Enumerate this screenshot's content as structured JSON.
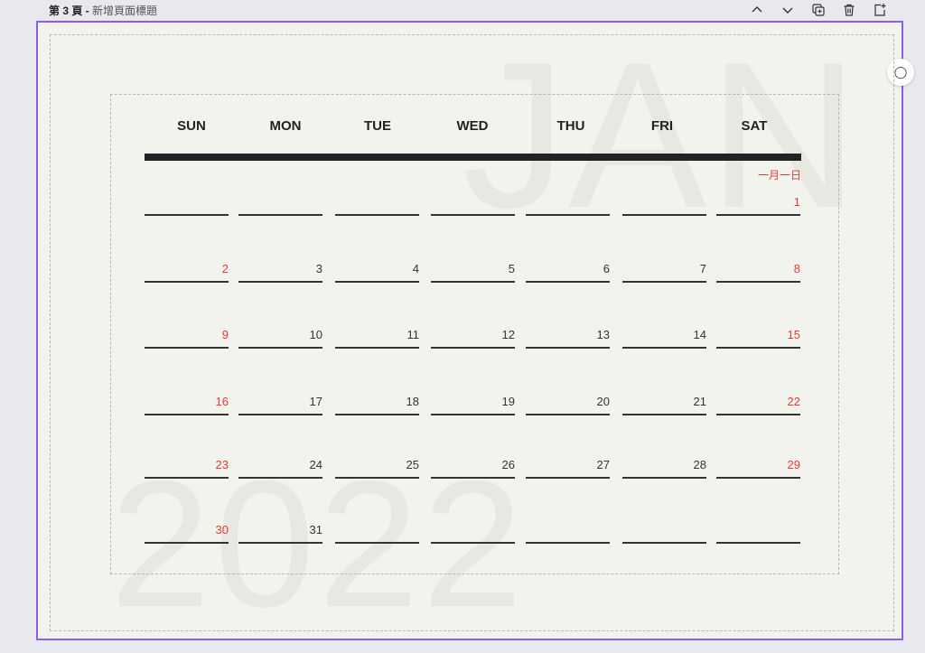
{
  "page": {
    "number_label": "第 3 頁",
    "separator": " - ",
    "title": "新增頁面標題"
  },
  "toolbar": {
    "up_icon": "chevron-up-icon",
    "down_icon": "chevron-down-icon",
    "duplicate_icon": "duplicate-icon",
    "delete_icon": "trash-icon",
    "add_icon": "add-page-icon"
  },
  "colors": {
    "selection": "#8b5cf6",
    "weekend": "#e53935",
    "ink": "#222222",
    "paper": "#f3f3ee"
  },
  "calendar": {
    "month_watermark": "JAN",
    "year_watermark": "2022",
    "lunar_note": "一月一日",
    "weekdays": [
      "SUN",
      "MON",
      "TUE",
      "WED",
      "THU",
      "FRI",
      "SAT"
    ],
    "weeks": [
      [
        "",
        "",
        "",
        "",
        "",
        "",
        "1"
      ],
      [
        "2",
        "3",
        "4",
        "5",
        "6",
        "7",
        "8"
      ],
      [
        "9",
        "10",
        "11",
        "12",
        "13",
        "14",
        "15"
      ],
      [
        "16",
        "17",
        "18",
        "19",
        "20",
        "21",
        "22"
      ],
      [
        "23",
        "24",
        "25",
        "26",
        "27",
        "28",
        "29"
      ],
      [
        "30",
        "31",
        "",
        "",
        "",
        "",
        ""
      ]
    ]
  }
}
